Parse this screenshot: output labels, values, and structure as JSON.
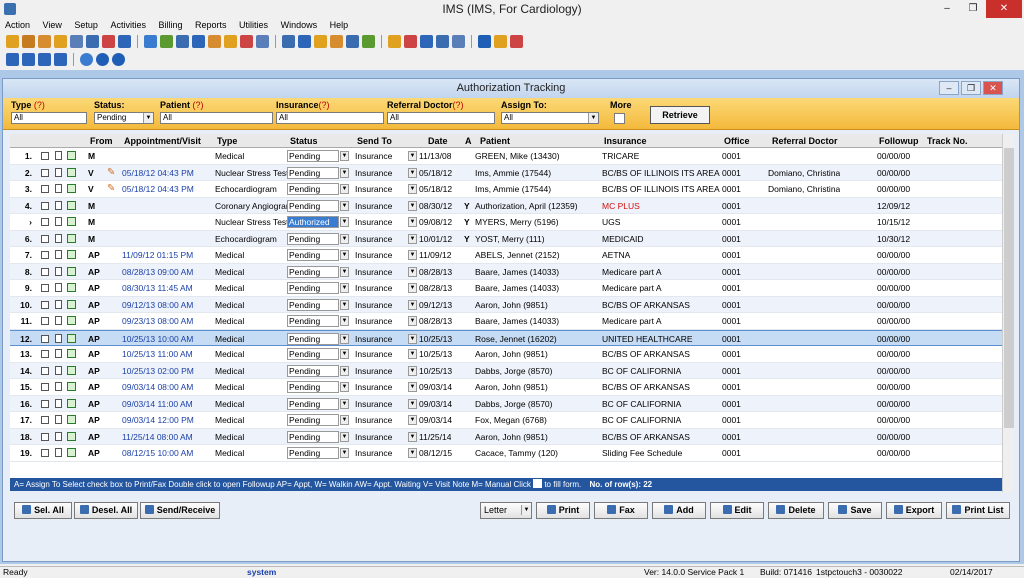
{
  "window": {
    "title": "IMS (IMS, For Cardiology)"
  },
  "menu": [
    "Action",
    "View",
    "Setup",
    "Activities",
    "Billing",
    "Reports",
    "Utilities",
    "Windows",
    "Help"
  ],
  "subwindow": {
    "title": "Authorization Tracking"
  },
  "filters": {
    "type_label": "Type",
    "type_value": "All",
    "status_label": "Status:",
    "status_value": "Pending",
    "patient_label": "Patient",
    "patient_value": "All",
    "insurance_label": "Insurance",
    "insurance_value": "All",
    "refdoc_label": "Referral Doctor",
    "refdoc_value": "All",
    "assign_label": "Assign To:",
    "assign_value": "All",
    "more_label": "More",
    "help_mark": "(?)",
    "retrieve_label": "Retrieve"
  },
  "columns": [
    "From",
    "Appointment/Visit",
    "Type",
    "Status",
    "Send To",
    "Date",
    "A",
    "Patient",
    "Insurance",
    "Office",
    "Referral Doctor",
    "Followup",
    "Track No."
  ],
  "rows": [
    {
      "n": "1.",
      "from": "M",
      "appt": "",
      "type": "Medical",
      "status": "Pending",
      "send": "Insurance",
      "date": "11/13/08",
      "a": "",
      "patient": "GREEN, Mike  (13430)",
      "ins": "TRICARE",
      "office": "0001",
      "ref": "",
      "fu": "00/00/00"
    },
    {
      "n": "2.",
      "from": "V",
      "appt": "05/18/12 04:43 PM",
      "type": "Nuclear Stress Test",
      "status": "Pending",
      "send": "Insurance",
      "date": "05/18/12",
      "a": "",
      "patient": "Ims, Ammie  (17544)",
      "ins": "BC/BS OF ILLINOIS ITS AREA",
      "office": "0001",
      "ref": "Domiano, Christina",
      "fu": "00/00/00"
    },
    {
      "n": "3.",
      "from": "V",
      "appt": "05/18/12 04:43 PM",
      "type": "Echocardiogram",
      "status": "Pending",
      "send": "Insurance",
      "date": "05/18/12",
      "a": "",
      "patient": "Ims, Ammie  (17544)",
      "ins": "BC/BS OF ILLINOIS ITS AREA",
      "office": "0001",
      "ref": "Domiano, Christina",
      "fu": "00/00/00"
    },
    {
      "n": "4.",
      "from": "M",
      "appt": "",
      "type": "Coronary Angiogram",
      "status": "Pending",
      "send": "Insurance",
      "date": "08/30/12",
      "a": "Y",
      "patient": "Authorization, April  (12359)",
      "ins": "MC PLUS",
      "office": "0001",
      "ref": "",
      "fu": "12/09/12"
    },
    {
      "n": "›",
      "from": "M",
      "appt": "",
      "type": "Nuclear Stress Test",
      "status": "Authorized",
      "send": "Insurance",
      "date": "09/08/12",
      "a": "Y",
      "patient": "MYERS, Merry  (5196)",
      "ins": "UGS",
      "office": "0001",
      "ref": "",
      "fu": "10/15/12"
    },
    {
      "n": "6.",
      "from": "M",
      "appt": "",
      "type": "Echocardiogram",
      "status": "Pending",
      "send": "Insurance",
      "date": "10/01/12",
      "a": "Y",
      "patient": "YOST, Merry  (111)",
      "ins": "MEDICAID",
      "office": "0001",
      "ref": "",
      "fu": "10/30/12"
    },
    {
      "n": "7.",
      "from": "AP",
      "appt": "11/09/12 01:15 PM",
      "type": "Medical",
      "status": "Pending",
      "send": "Insurance",
      "date": "11/09/12",
      "a": "",
      "patient": "ABELS, Jennet  (2152)",
      "ins": "AETNA",
      "office": "0001",
      "ref": "",
      "fu": "00/00/00"
    },
    {
      "n": "8.",
      "from": "AP",
      "appt": "08/28/13 09:00 AM",
      "type": "Medical",
      "status": "Pending",
      "send": "Insurance",
      "date": "08/28/13",
      "a": "",
      "patient": "Baare, James  (14033)",
      "ins": "Medicare part A",
      "office": "0001",
      "ref": "",
      "fu": "00/00/00"
    },
    {
      "n": "9.",
      "from": "AP",
      "appt": "08/30/13 11:45 AM",
      "type": "Medical",
      "status": "Pending",
      "send": "Insurance",
      "date": "08/28/13",
      "a": "",
      "patient": "Baare, James  (14033)",
      "ins": "Medicare part A",
      "office": "0001",
      "ref": "",
      "fu": "00/00/00"
    },
    {
      "n": "10.",
      "from": "AP",
      "appt": "09/12/13 08:00 AM",
      "type": "Medical",
      "status": "Pending",
      "send": "Insurance",
      "date": "09/12/13",
      "a": "",
      "patient": "Aaron, John  (9851)",
      "ins": "BC/BS OF ARKANSAS",
      "office": "0001",
      "ref": "",
      "fu": "00/00/00"
    },
    {
      "n": "11.",
      "from": "AP",
      "appt": "09/23/13 08:00 AM",
      "type": "Medical",
      "status": "Pending",
      "send": "Insurance",
      "date": "08/28/13",
      "a": "",
      "patient": "Baare, James  (14033)",
      "ins": "Medicare part A",
      "office": "0001",
      "ref": "",
      "fu": "00/00/00"
    },
    {
      "n": "12.",
      "from": "AP",
      "appt": "10/25/13 10:00 AM",
      "type": "Medical",
      "status": "Pending",
      "send": "Insurance",
      "date": "10/25/13",
      "a": "",
      "patient": "Rose, Jennet  (16202)",
      "ins": "UNITED HEALTHCARE",
      "office": "0001",
      "ref": "",
      "fu": "00/00/00"
    },
    {
      "n": "13.",
      "from": "AP",
      "appt": "10/25/13 11:00 AM",
      "type": "Medical",
      "status": "Pending",
      "send": "Insurance",
      "date": "10/25/13",
      "a": "",
      "patient": "Aaron, John  (9851)",
      "ins": "BC/BS OF ARKANSAS",
      "office": "0001",
      "ref": "",
      "fu": "00/00/00"
    },
    {
      "n": "14.",
      "from": "AP",
      "appt": "10/25/13 02:00 PM",
      "type": "Medical",
      "status": "Pending",
      "send": "Insurance",
      "date": "10/25/13",
      "a": "",
      "patient": "Dabbs, Jorge  (8570)",
      "ins": "BC OF CALIFORNIA",
      "office": "0001",
      "ref": "",
      "fu": "00/00/00"
    },
    {
      "n": "15.",
      "from": "AP",
      "appt": "09/03/14 08:00 AM",
      "type": "Medical",
      "status": "Pending",
      "send": "Insurance",
      "date": "09/03/14",
      "a": "",
      "patient": "Aaron, John  (9851)",
      "ins": "BC/BS OF ARKANSAS",
      "office": "0001",
      "ref": "",
      "fu": "00/00/00"
    },
    {
      "n": "16.",
      "from": "AP",
      "appt": "09/03/14 11:00 AM",
      "type": "Medical",
      "status": "Pending",
      "send": "Insurance",
      "date": "09/03/14",
      "a": "",
      "patient": "Dabbs, Jorge  (8570)",
      "ins": "BC OF CALIFORNIA",
      "office": "0001",
      "ref": "",
      "fu": "00/00/00"
    },
    {
      "n": "17.",
      "from": "AP",
      "appt": "09/03/14 12:00 PM",
      "type": "Medical",
      "status": "Pending",
      "send": "Insurance",
      "date": "09/03/14",
      "a": "",
      "patient": "Fox, Megan  (6768)",
      "ins": "BC OF CALIFORNIA",
      "office": "0001",
      "ref": "",
      "fu": "00/00/00"
    },
    {
      "n": "18.",
      "from": "AP",
      "appt": "11/25/14 08:00 AM",
      "type": "Medical",
      "status": "Pending",
      "send": "Insurance",
      "date": "11/25/14",
      "a": "",
      "patient": "Aaron, John  (9851)",
      "ins": "BC/BS OF ARKANSAS",
      "office": "0001",
      "ref": "",
      "fu": "00/00/00"
    },
    {
      "n": "19.",
      "from": "AP",
      "appt": "08/12/15 10:00 AM",
      "type": "Medical",
      "status": "Pending",
      "send": "Insurance",
      "date": "08/12/15",
      "a": "",
      "patient": "Cacace, Tammy  (120)",
      "ins": "Sliding Fee Schedule",
      "office": "0001",
      "ref": "",
      "fu": "00/00/00"
    }
  ],
  "legend": "A= Assign To    Select check box to Print/Fax    Double click to open Followup    AP= Appt, W= Walkin  AW= Appt. Waiting  V= Visit Note  M= Manual   Click",
  "legend_tail": "to fill form.",
  "row_count": "No. of row(s): 22",
  "buttons": {
    "selall": "Sel. All",
    "deselall": "Desel. All",
    "sendrecv": "Send/Receive",
    "paper": "Letter",
    "print": "Print",
    "fax": "Fax",
    "add": "Add",
    "edit": "Edit",
    "delete": "Delete",
    "save": "Save",
    "export": "Export",
    "printlist": "Print List"
  },
  "statusbar": {
    "ready": "Ready",
    "user": "system",
    "ver": "Ver: 14.0.0 Service Pack 1",
    "build": "Build: 071416",
    "station": "1stpctouch3 - 0030022",
    "date": "02/14/2017"
  }
}
